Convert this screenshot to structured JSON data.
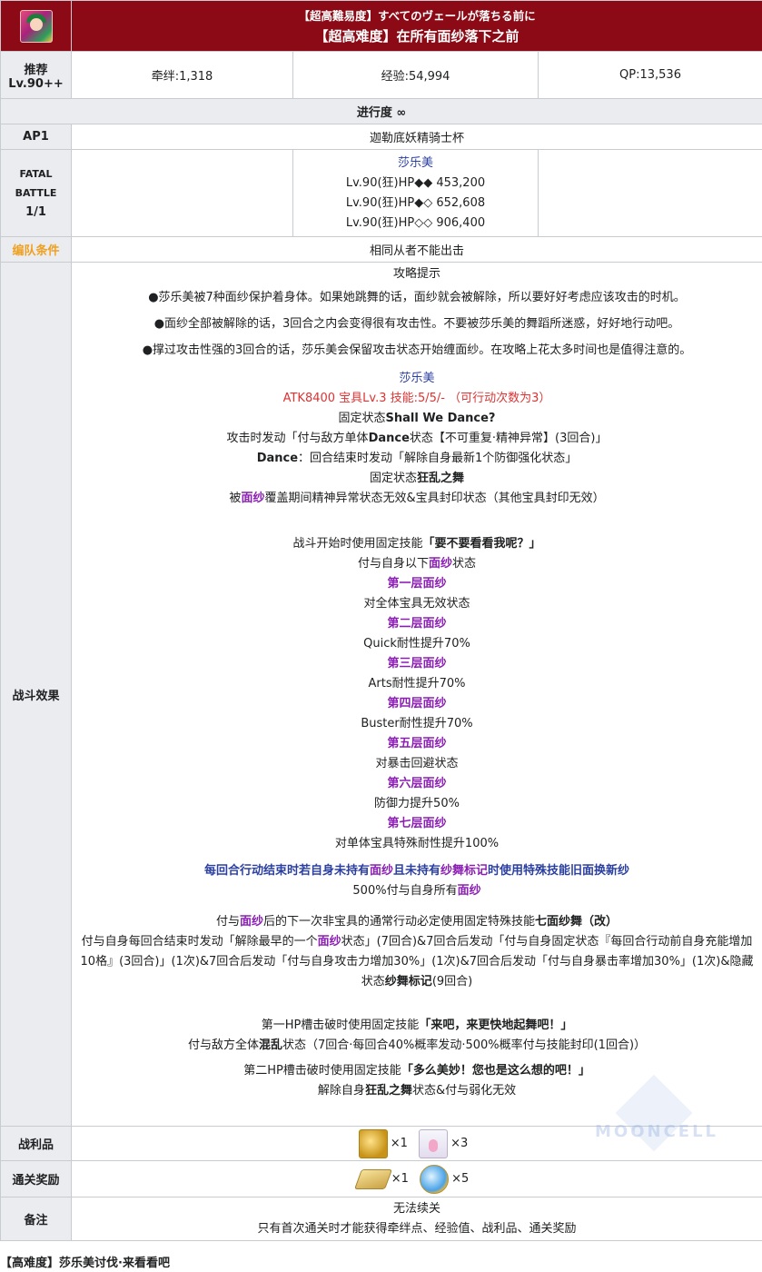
{
  "header": {
    "title_jp": "【超高難易度】すべてのヴェールが落ちる前に",
    "title_cn": "【超高难度】在所有面纱落下之前"
  },
  "rec": {
    "label_1": "推荐",
    "label_2": "Lv.90++",
    "bond": "牵绊:1,318",
    "exp": "经验:54,994",
    "qp": "QP:13,536"
  },
  "progress": "进行度 ∞",
  "ap": {
    "label": "AP1",
    "value": "迦勒底妖精骑士杯"
  },
  "battle": {
    "label_1": "FATAL",
    "label_2": "BATTLE",
    "label_3": "1/1",
    "enemy": "莎乐美",
    "hp": [
      "Lv.90(狂)HP◆◆ 453,200",
      "Lv.90(狂)HP◆◇ 652,608",
      "Lv.90(狂)HP◇◇ 906,400"
    ]
  },
  "formation": {
    "label": "编队条件",
    "value": "相同从者不能出击"
  },
  "effect": {
    "label": "战斗效果",
    "tips_title": "攻略提示",
    "tips": [
      "●莎乐美被7种面纱保护着身体。如果她跳舞的话，面纱就会被解除，所以要好好考虑应该攻击的时机。",
      "●面纱全部被解除的话，3回合之内会变得很有攻击性。不要被莎乐美的舞蹈所迷惑，好好地行动吧。",
      "●撑过攻击性强的3回合的话，莎乐美会保留攻击状态开始缠面纱。在攻略上花太多时间也是值得注意的。"
    ],
    "boss_name": "莎乐美",
    "boss_stats": "ATK8400 宝具Lv.3 技能:5/5/- （可行动次数为3）",
    "fixed1_prefix": "固定状态",
    "fixed1_name": "Shall We Dance?",
    "fixed1_d1_a": "攻击时发动「付与敌方单体",
    "fixed1_d1_b": "Dance",
    "fixed1_d1_c": "状态【不可重复·精神异常】(3回合)」",
    "fixed1_d2_a": "Dance",
    "fixed1_d2_b": "：回合结束时发动「解除自身最新1个防御强化状态」",
    "fixed2_prefix": "固定状态",
    "fixed2_name": "狂乱之舞",
    "fixed2_d_a": "被",
    "fixed2_d_b": "面纱",
    "fixed2_d_c": "覆盖期间精神异常状态无效&宝具封印状态（其他宝具封印无效）",
    "start_a": "战斗开始时使用固定技能",
    "start_b": "「要不要看看我呢？」",
    "start_d_a": "付与自身以下",
    "start_d_b": "面纱",
    "start_d_c": "状态",
    "veils": [
      {
        "name": "第一层面纱",
        "effect": "对全体宝具无效状态"
      },
      {
        "name": "第二层面纱",
        "effect": "Quick耐性提升70%"
      },
      {
        "name": "第三层面纱",
        "effect": "Arts耐性提升70%"
      },
      {
        "name": "第四层面纱",
        "effect": "Buster耐性提升70%"
      },
      {
        "name": "第五层面纱",
        "effect": "对暴击回避状态"
      },
      {
        "name": "第六层面纱",
        "effect": "防御力提升50%"
      },
      {
        "name": "第七层面纱",
        "effect": "对单体宝具特殊耐性提升100%"
      }
    ],
    "turn_a": "每回合行动结束时若自身未持有",
    "turn_b": "面纱",
    "turn_c": "且未持有",
    "turn_d": "纱舞标记",
    "turn_e": "时使用特殊技能",
    "turn_f": "旧面换新纱",
    "turn2_a": "500%付与自身所有",
    "turn2_b": "面纱",
    "next_a": "付与",
    "next_b": "面纱",
    "next_c": "后的下一次非宝具的通常行动必定使用固定特殊技能",
    "next_d": "七面纱舞（改）",
    "next2_a": "付与自身每回合结束时发动「解除最早的一个",
    "next2_b": "面纱",
    "next2_c": "状态」(7回合)&7回合后发动「付与自身固定状态『每回合行动前自身充能增加10格』(3回合)」(1次)&7回合后发动「付与自身攻击力增加30%」(1次)&7回合后发动「付与自身暴击率增加30%」(1次)&隐藏状态",
    "next2_d": "纱舞标记",
    "next2_e": "(9回合)",
    "hp1_a": "第一HP槽击破时使用固定技能",
    "hp1_b": "「来吧，来更快地起舞吧！」",
    "hp1_d_a": "付与敌方全体",
    "hp1_d_b": "混乱",
    "hp1_d_c": "状态（7回合·每回合40%概率发动·500%概率付与技能封印(1回合)）",
    "hp2_a": "第二HP槽击破时使用固定技能",
    "hp2_b": "「多么美妙！您也是这么想的吧！」",
    "hp2_d_a": "解除自身",
    "hp2_d_b": "狂乱之舞",
    "hp2_d_c": "状态&付与弱化无效"
  },
  "drops": {
    "label": "战利品",
    "q1": "×1",
    "q2": "×3"
  },
  "reward": {
    "label": "通关奖励",
    "q1": "×1",
    "q2": "×5"
  },
  "notes": {
    "label": "备注",
    "line1": "无法续关",
    "line2": "只有首次通关时才能获得牵绊点、经验值、战利品、通关奖励"
  },
  "watermark": "MOONCELL",
  "footer": "【高难度】莎乐美讨伐·来看看吧"
}
